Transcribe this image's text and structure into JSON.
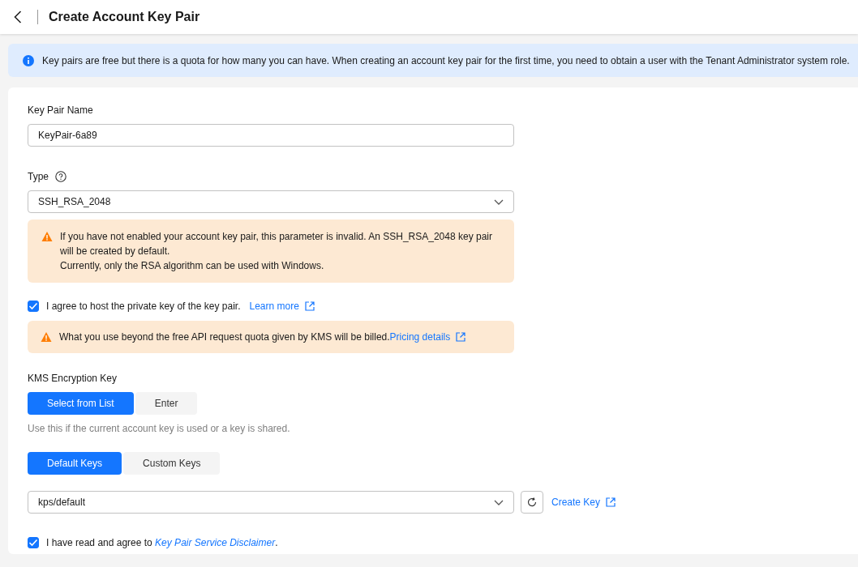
{
  "header": {
    "title": "Create Account Key Pair"
  },
  "notice": {
    "text": "Key pairs are free but there is a quota for how many you can have. When creating an account key pair for the first time, you need to obtain a user with the Tenant Administrator system role."
  },
  "name_field": {
    "label": "Key Pair Name",
    "value": "KeyPair-6a89"
  },
  "type_field": {
    "label": "Type",
    "value": "SSH_RSA_2048"
  },
  "type_warning": {
    "lines": [
      "If you have not enabled your account key pair, this parameter is invalid. An SSH_RSA_2048 key pair will be created by default.",
      "Currently, only the RSA algorithm can be used with Windows."
    ]
  },
  "host_agreement": {
    "checked": true,
    "label": "I agree to host the private key of the key pair.",
    "link": "Learn more"
  },
  "billing_warning": {
    "text": "What you use beyond the free API request quota given by KMS will be billed.",
    "link": "Pricing details"
  },
  "kms": {
    "label": "KMS Encryption Key",
    "modes": [
      {
        "label": "Select from List",
        "selected": true
      },
      {
        "label": "Enter",
        "selected": false
      }
    ],
    "hint": "Use this if the current account key is used or a key is shared.",
    "key_sets": [
      {
        "label": "Default Keys",
        "selected": true
      },
      {
        "label": "Custom Keys",
        "selected": false
      }
    ],
    "key_value": "kps/default",
    "create_link": "Create Key"
  },
  "disclaimer": {
    "checked": true,
    "text": "I have read and agree to ",
    "link": "Key Pair Service Disclaimer",
    "suffix": "."
  }
}
